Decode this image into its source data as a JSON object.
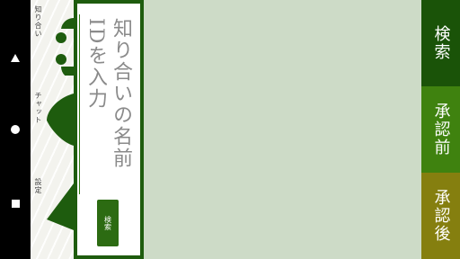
{
  "colors": {
    "primary": "#1e5c0e",
    "content_bg": "#cddbc7",
    "nav_search": "#1a5308",
    "nav_before": "#3f820f",
    "nav_after": "#857f0f"
  },
  "system_nav": {
    "back_icon": "triangle-back",
    "home_icon": "circle-home",
    "recents_icon": "square-recents"
  },
  "tabs": [
    {
      "label": "知り合い",
      "icon": "face-icon"
    },
    {
      "label": "チャット",
      "icon": "leaf-icon"
    },
    {
      "label": "設定",
      "icon": "triangle-icon"
    }
  ],
  "search": {
    "placeholder": "知り合いの名前IDを入力",
    "button_label": "検索"
  },
  "right_nav": [
    {
      "label": "検索"
    },
    {
      "label": "承認前"
    },
    {
      "label": "承認後"
    }
  ]
}
